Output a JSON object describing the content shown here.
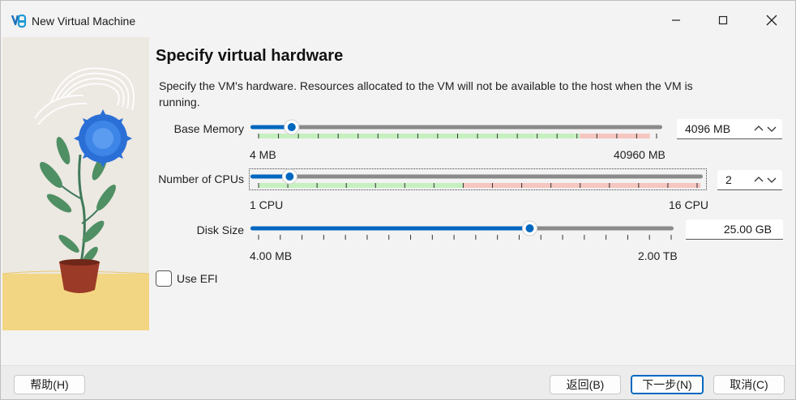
{
  "window": {
    "title": "New Virtual Machine"
  },
  "titlebar": {
    "minimize": "minimize",
    "maximize": "maximize",
    "close": "close"
  },
  "page": {
    "heading": "Specify virtual hardware",
    "description": "Specify the VM's hardware. Resources allocated to the VM will not be available to the host when the VM is running."
  },
  "memory": {
    "label": "Base Memory",
    "value": "4096 MB",
    "min_label": "4 MB",
    "max_label": "40960 MB",
    "level_fraction": 0.1
  },
  "cpus": {
    "label": "Number of CPUs",
    "value": "2",
    "min_label": "1 CPU",
    "max_label": "16 CPU",
    "level": 2,
    "max": 16
  },
  "disk": {
    "label": "Disk Size",
    "value": "25.00 GB",
    "min_label": "4.00 MB",
    "max_label": "2.00 TB",
    "level_fraction": 0.66
  },
  "efi": {
    "label": "Use EFI",
    "checked": false
  },
  "footer": {
    "help": "帮助(H)",
    "back": "返回(B)",
    "next": "下一步(N)",
    "cancel": "取消(C)"
  },
  "colors": {
    "accent": "#0067c0",
    "track": "#8a8a8a",
    "safe_zone": "#c6f0c0",
    "warn_zone": "#f6c6c0"
  }
}
